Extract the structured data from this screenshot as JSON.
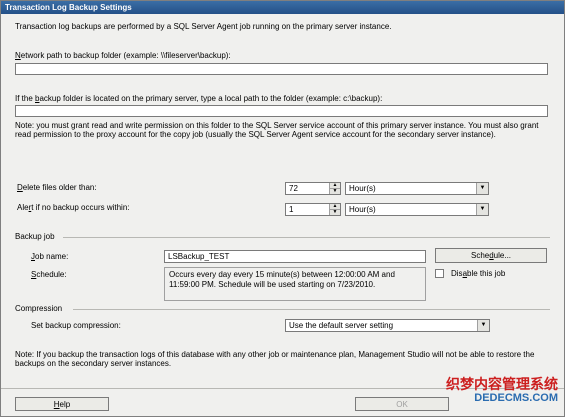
{
  "window": {
    "title": "Transaction Log Backup Settings"
  },
  "intro": "Transaction log backups are performed by a SQL Server Agent job running on the primary server instance.",
  "network_path": {
    "label_prefix": "",
    "label_ul": "N",
    "label_rest": "etwork path to backup folder (example: \\\\fileserver\\backup):",
    "value": ""
  },
  "local_path": {
    "label_pre": "If the ",
    "label_ul": "b",
    "label_rest": "ackup folder is located on the primary server, type a local path to the folder (example: c:\\backup):",
    "value": ""
  },
  "note": "Note: you must grant read and write permission on this folder to the SQL Server service account of this primary server instance. You must also grant read permission to the proxy account for the copy job (usually the SQL Server Agent service account for the secondary server instance).",
  "delete_files": {
    "label_ul": "D",
    "label_rest": "elete files older than:",
    "value": "72",
    "unit": "Hour(s)"
  },
  "alert": {
    "label_pre": "Ale",
    "label_ul": "r",
    "label_rest": "t if no backup occurs within:",
    "value": "1",
    "unit": "Hour(s)"
  },
  "backup_job": {
    "heading": "Backup job",
    "job_name_label_ul": "J",
    "job_name_label_rest": "ob name:",
    "job_name_value": "LSBackup_TEST",
    "schedule_button_pre": "Sche",
    "schedule_button_ul": "d",
    "schedule_button_rest": "ule...",
    "schedule_label_ul": "S",
    "schedule_label_rest": "chedule:",
    "schedule_text": "Occurs every day every 15 minute(s) between 12:00:00 AM and 11:59:00 PM. Schedule will be used starting on 7/23/2010.",
    "disable_pre": "Dis",
    "disable_ul": "a",
    "disable_rest": "ble this job"
  },
  "compression": {
    "heading": "Compression",
    "label": "Set backup compression:",
    "value": "Use the default server setting"
  },
  "bottom_note": "Note: If you backup the transaction logs of this database with any other job or maintenance plan, Management Studio will not be able to restore the backups on the secondary server instances.",
  "footer": {
    "help_ul": "H",
    "help_rest": "elp",
    "ok": "OK"
  },
  "watermark": {
    "line1": "织梦内容管理系统",
    "line2": "DEDECMS.COM"
  }
}
